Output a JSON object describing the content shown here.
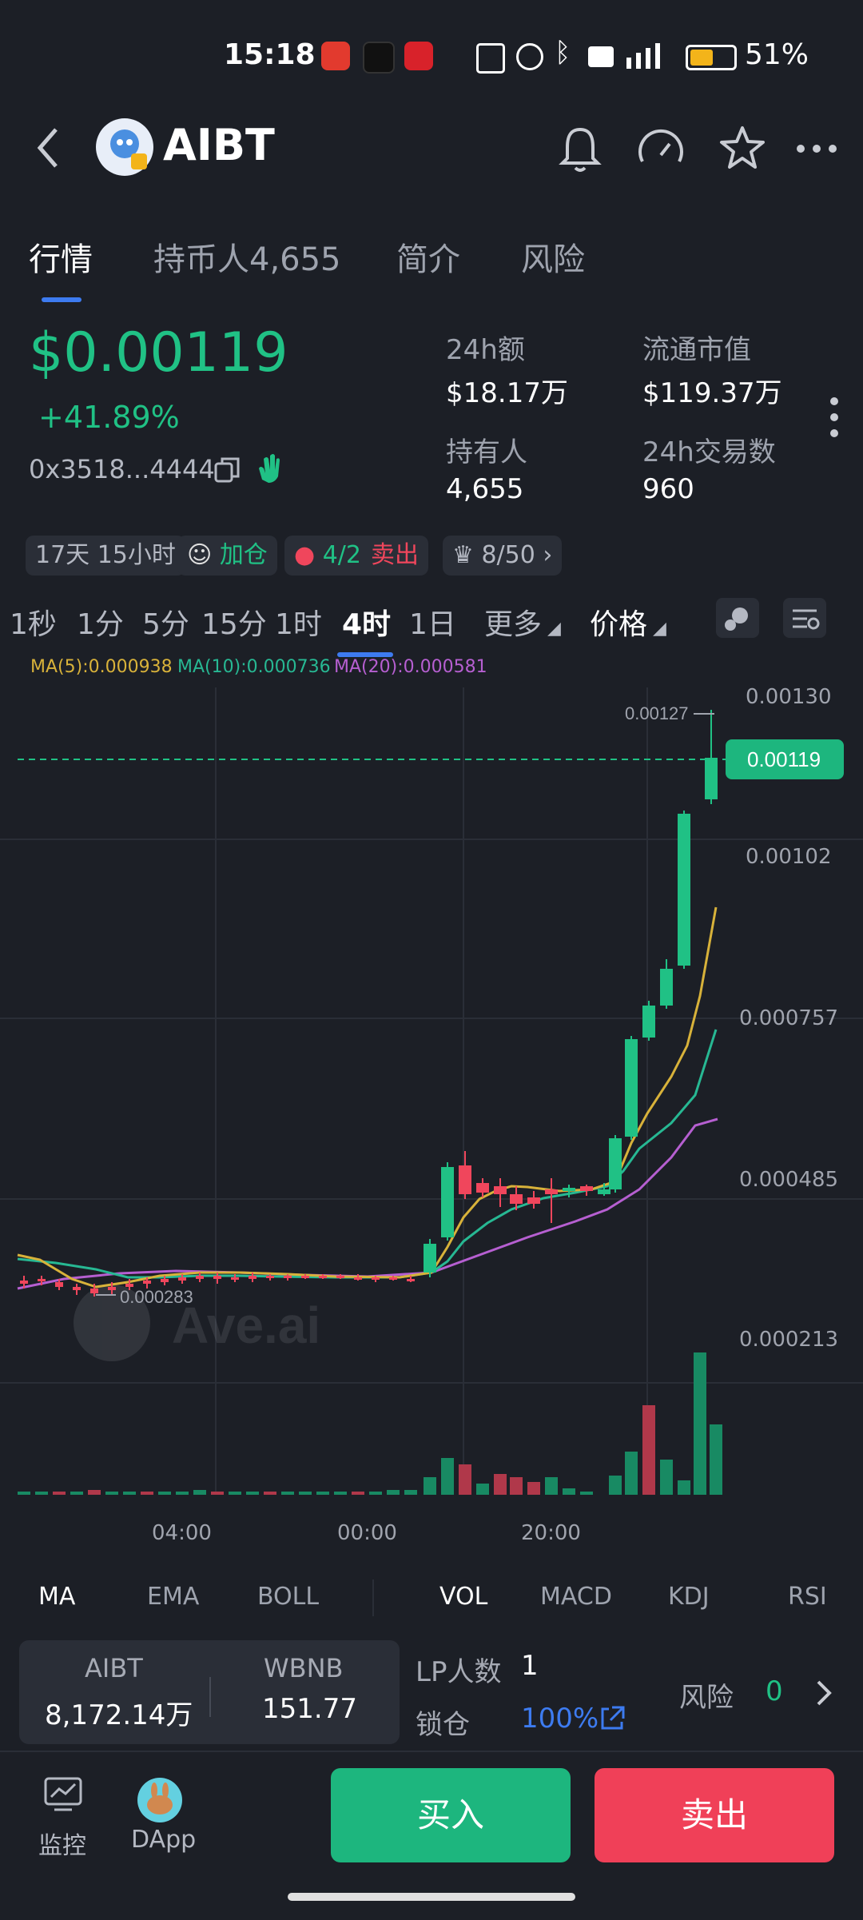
{
  "status_bar": {
    "time": "15:18",
    "battery_pct": "51%",
    "battery_level": 0.51
  },
  "header": {
    "title": "AIBT"
  },
  "tabs": [
    {
      "label": "行情",
      "active": true
    },
    {
      "label": "持币人4,655",
      "active": false
    },
    {
      "label": "简介",
      "active": false
    },
    {
      "label": "风险",
      "active": false
    }
  ],
  "price": {
    "value": "$0.00119",
    "change": "+41.89%",
    "address": "0x3518...4444"
  },
  "stats": {
    "vol_label": "24h额",
    "vol_value": "$18.17万",
    "mcap_label": "流通市值",
    "mcap_value": "$119.37万",
    "holders_label": "持有人",
    "holders_value": "4,655",
    "tx_label": "24h交易数",
    "tx_value": "960"
  },
  "chips": {
    "age": "17天 15小时",
    "add": "加仓",
    "buysell": "4/2",
    "sell": "卖出",
    "rank": "8/50"
  },
  "timeframes": [
    "1秒",
    "1分",
    "5分",
    "15分",
    "1时",
    "4时",
    "1日"
  ],
  "more_label": "更多",
  "price_label": "价格",
  "ma_legend": {
    "ma5": "MA(5):0.000938",
    "ma10": "MA(10):0.000736",
    "ma20": "MA(20):0.000581"
  },
  "chart_data": {
    "type": "candlestick",
    "y_ticks": [
      "0.00130",
      "0.00102",
      "0.000757",
      "0.000485",
      "0.000213"
    ],
    "x_ticks": [
      "04:00",
      "00:00",
      "20:00"
    ],
    "current_price": "0.00119",
    "high_label": "0.00127",
    "low_label": "0.000283",
    "watermark": "Ave.ai",
    "colors": {
      "up": "#20c185",
      "down": "#f0465c",
      "ma5": "#d8b23a",
      "ma10": "#27b893",
      "ma20": "#b65fd1"
    }
  },
  "indicators": [
    "MA",
    "EMA",
    "BOLL",
    "VOL",
    "MACD",
    "KDJ",
    "RSI"
  ],
  "pool": {
    "token_a": "AIBT",
    "token_a_value": "8,172.14万",
    "token_b": "WBNB",
    "token_b_value": "151.77"
  },
  "lp": {
    "label": "LP人数",
    "value": "1",
    "lock_label": "锁仓",
    "lock_value": "100%"
  },
  "risk": {
    "label": "风险",
    "value": "0"
  },
  "footer": {
    "monitor": "监控",
    "dapp": "DApp",
    "buy": "买入",
    "sell": "卖出"
  }
}
